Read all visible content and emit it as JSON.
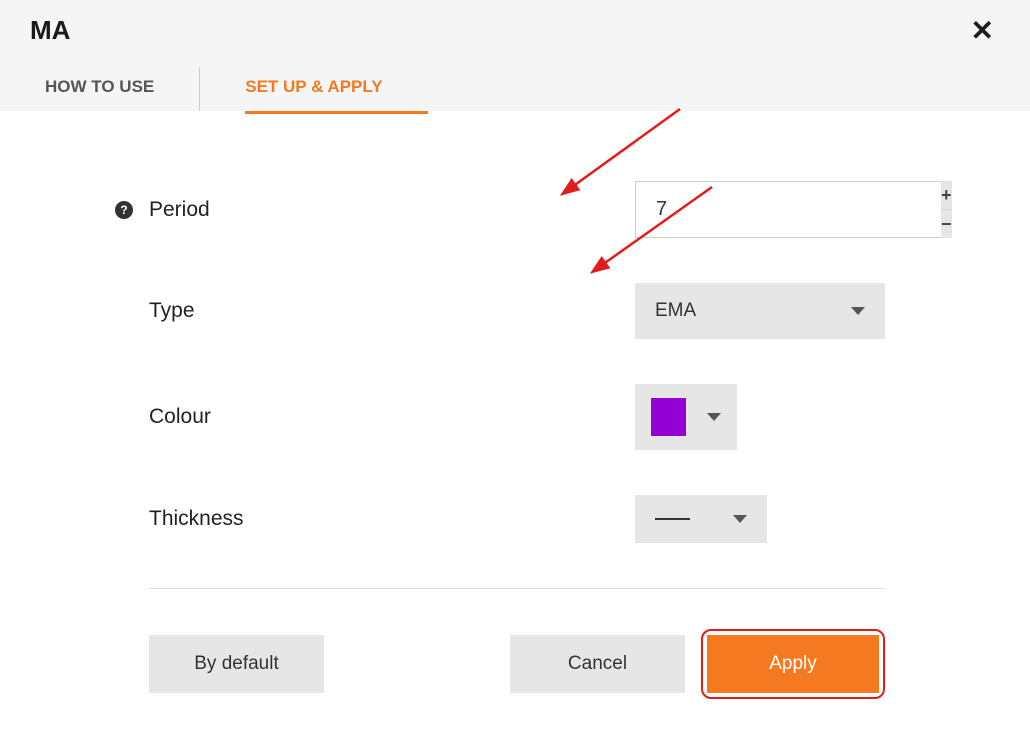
{
  "header": {
    "title": "MA",
    "tabs": {
      "howto": "HOW TO USE",
      "setup": "SET UP & APPLY"
    }
  },
  "fields": {
    "period": {
      "label": "Period",
      "value": "7"
    },
    "type": {
      "label": "Type",
      "value": "EMA"
    },
    "colour": {
      "label": "Colour",
      "value": "#9400d3"
    },
    "thickness": {
      "label": "Thickness"
    }
  },
  "buttons": {
    "default": "By default",
    "cancel": "Cancel",
    "apply": "Apply"
  }
}
